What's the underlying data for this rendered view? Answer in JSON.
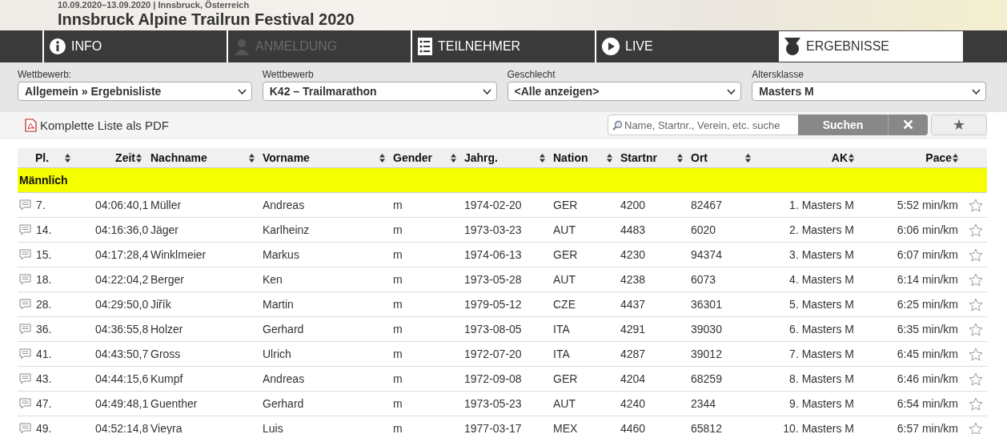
{
  "header": {
    "subtitle": "10.09.2020–13.09.2020 | Innsbruck, Österreich",
    "title": "Innsbruck Alpine Trailrun Festival 2020"
  },
  "tabs": [
    {
      "label": "INFO",
      "selected": false,
      "disabled": false
    },
    {
      "label": "ANMELDUNG",
      "selected": false,
      "disabled": true
    },
    {
      "label": "TEILNEHMER",
      "selected": false,
      "disabled": false
    },
    {
      "label": "LIVE",
      "selected": false,
      "disabled": false
    },
    {
      "label": "ERGEBNISSE",
      "selected": true,
      "disabled": false
    }
  ],
  "filters": [
    {
      "label": "Wettbewerb:",
      "value": "Allgemein » Ergebnisliste"
    },
    {
      "label": "Wettbewerb",
      "value": "K42 – Trailmarathon"
    },
    {
      "label": "Geschlecht",
      "value": "<Alle anzeigen>"
    },
    {
      "label": "Altersklasse",
      "value": "Masters M"
    }
  ],
  "toolbar": {
    "pdf_link": "Komplette Liste als PDF",
    "search": {
      "placeholder": "Name, Startnr., Verein, etc. suche"
    },
    "search_button": "Suchen",
    "clear_button": "✕",
    "favorites_button": "★"
  },
  "table": {
    "columns": [
      "Pl.",
      "Zeit",
      "Nachname",
      "Vorname",
      "Gender",
      "Jahrg.",
      "Nation",
      "Startnr",
      "Ort",
      "AK",
      "Pace"
    ],
    "group": "Männlich",
    "rows": [
      {
        "cells": [
          "7.",
          "04:06:40,1",
          "Müller",
          "Andreas",
          "m",
          "1974-02-20",
          "GER",
          "4200",
          "82467",
          "1. Masters M",
          "5:52 min/km"
        ],
        "favorite": false
      },
      {
        "cells": [
          "14.",
          "04:16:36,0",
          "Jäger",
          "Karlheinz",
          "m",
          "1973-03-23",
          "AUT",
          "4483",
          "6020",
          "2. Masters M",
          "6:06 min/km"
        ],
        "favorite": false
      },
      {
        "cells": [
          "15.",
          "04:17:28,4",
          "Winklmeier",
          "Markus",
          "m",
          "1974-06-13",
          "GER",
          "4230",
          "94374",
          "3. Masters M",
          "6:07 min/km"
        ],
        "favorite": false
      },
      {
        "cells": [
          "18.",
          "04:22:04,2",
          "Berger",
          "Ken",
          "m",
          "1973-05-28",
          "AUT",
          "4238",
          "6073",
          "4. Masters M",
          "6:14 min/km"
        ],
        "favorite": false
      },
      {
        "cells": [
          "28.",
          "04:29:50,0",
          "Jiřík",
          "Martin",
          "m",
          "1979-05-12",
          "CZE",
          "4437",
          "36301",
          "5. Masters M",
          "6:25 min/km"
        ],
        "favorite": false
      },
      {
        "cells": [
          "36.",
          "04:36:55,8",
          "Holzer",
          "Gerhard",
          "m",
          "1973-08-05",
          "ITA",
          "4291",
          "39030",
          "6. Masters M",
          "6:35 min/km"
        ],
        "favorite": false
      },
      {
        "cells": [
          "41.",
          "04:43:50,7",
          "Gross",
          "Ulrich",
          "m",
          "1972-07-20",
          "ITA",
          "4287",
          "39012",
          "7. Masters M",
          "6:45 min/km"
        ],
        "favorite": false
      },
      {
        "cells": [
          "43.",
          "04:44:15,6",
          "Kumpf",
          "Andreas",
          "m",
          "1972-09-08",
          "GER",
          "4204",
          "68259",
          "8. Masters M",
          "6:46 min/km"
        ],
        "favorite": false
      },
      {
        "cells": [
          "47.",
          "04:49:48,1",
          "Guenther",
          "Gerhard",
          "m",
          "1973-05-23",
          "AUT",
          "4240",
          "2344",
          "9. Masters M",
          "6:54 min/km"
        ],
        "favorite": false
      },
      {
        "cells": [
          "49.",
          "04:52:14,8",
          "Vieyra",
          "Luis",
          "m",
          "1977-03-17",
          "MEX",
          "4460",
          "65812",
          "10. Masters M",
          "6:57 min/km"
        ],
        "favorite": false
      }
    ]
  }
}
